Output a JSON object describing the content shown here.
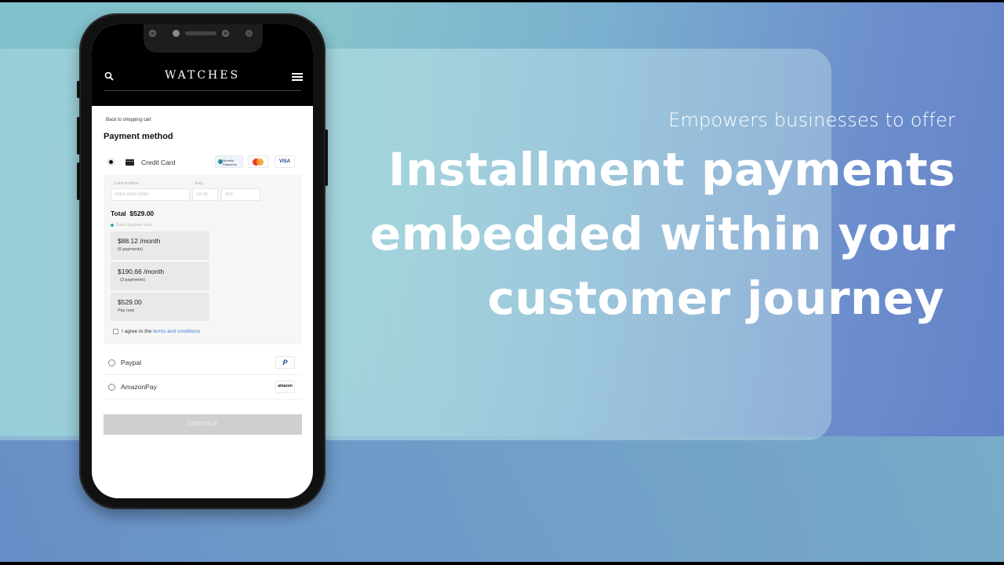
{
  "headline": {
    "subtitle": "Empowers businesses to offer",
    "lines": [
      "Installment payments",
      "embedded within your",
      "customer journey"
    ]
  },
  "app": {
    "brand": "WATCHES",
    "icons": {
      "search": "search-icon",
      "menu": "hamburger-menu-icon"
    },
    "back_link": "Back to shopping cart",
    "title": "Payment method",
    "credit_card": {
      "label": "Credit Card",
      "selected": true,
      "logos": {
        "monthly": "Monthly Payments",
        "mastercard": "",
        "visa": "VISA"
      },
      "fields": {
        "card_number_label": "Card number",
        "card_number_placeholder": "XXXX-XXXX-XXXX",
        "exp_label": "Exp.",
        "exp_placeholder": "XX-XX",
        "cvv_placeholder": "XXX"
      },
      "total_label": "Total",
      "total_value": "$529.00",
      "plan_hint": "Select payment plan",
      "plans": [
        {
          "amount": "$88.12 /month",
          "note": "(6 payments)"
        },
        {
          "amount": "$190.66 /month",
          "note": "(3 payments)"
        },
        {
          "amount": "$529.00",
          "note": "Pay now"
        }
      ],
      "agree_text": "I agree to the",
      "terms_link": "terms and conditions"
    },
    "alternatives": [
      {
        "label": "Paypal",
        "logo": "P"
      },
      {
        "label": "AmazonPay",
        "logo": "amazon"
      }
    ],
    "continue_label": "CONTINUE"
  },
  "colors": {
    "link": "#4a7fd0",
    "continue_disabled": "#cfcfcf",
    "header_bg": "#000000"
  }
}
